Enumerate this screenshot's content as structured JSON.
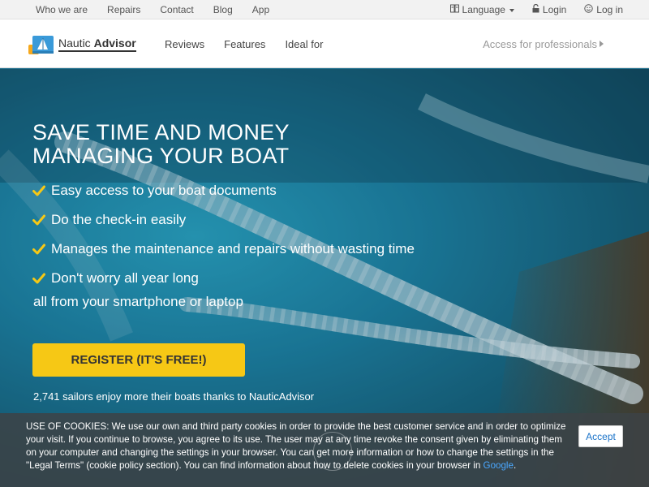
{
  "topbar": {
    "links": [
      "Who we are",
      "Repairs",
      "Contact",
      "Blog",
      "App"
    ],
    "language_label": "Language",
    "login_label": "Login",
    "signup_label": "Log in"
  },
  "navbar": {
    "brand_light": "Nautic ",
    "brand_bold": "Advisor",
    "links": [
      "Reviews",
      "Features",
      "Ideal for"
    ],
    "pro_label": "Access for professionals"
  },
  "hero": {
    "headline_line1": "SAVE TIME AND MONEY",
    "headline_line2": "MANAGING YOUR BOAT",
    "benefits": [
      "Easy access to your boat documents",
      "Do the check-in easily",
      "Manages the maintenance and repairs without wasting time",
      "Don't worry all year long"
    ],
    "tagline": "all from your smartphone or laptop",
    "register_label": "REGISTER (IT'S FREE!)",
    "sailors_text": "2,741 sailors enjoy more their boats thanks to NauticAdvisor"
  },
  "cookie": {
    "text": "USE OF COOKIES: We use our own and third party cookies in order to provide the best customer service and in order to optimize your visit. If you continue to browse, you agree to its use. The user may at any time revoke the consent given by eliminating them on your computer and changing the settings in your browser. You can get more information or how to change the settings in the \"Legal Terms\" (cookie policy section). You can find information about how to delete cookies in your browser in ",
    "link_label": "Google",
    "text_end": ".",
    "accept_label": "Accept"
  },
  "colors": {
    "accent_yellow": "#f6c815",
    "hero_blue": "#1d83a6",
    "link_blue": "#4aa8ff"
  }
}
